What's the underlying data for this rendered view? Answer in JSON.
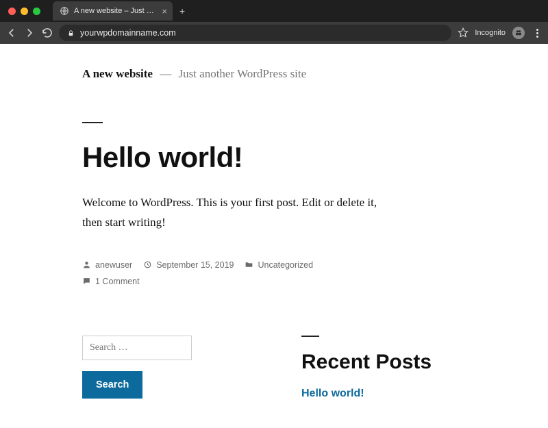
{
  "browser": {
    "tab_title": "A new website – Just another WordPress site",
    "url": "yourwpdomainname.com",
    "mode_label": "Incognito"
  },
  "site": {
    "title": "A new website",
    "separator": "—",
    "tagline": "Just another WordPress site"
  },
  "post": {
    "title": "Hello world!",
    "content": "Welcome to WordPress. This is your first post. Edit or delete it, then start writing!",
    "author": "anewuser",
    "date": "September 15, 2019",
    "category": "Uncategorized",
    "comments": "1 Comment"
  },
  "widgets": {
    "search": {
      "placeholder": "Search …",
      "button": "Search"
    },
    "recent": {
      "heading": "Recent Posts",
      "items": [
        "Hello world!"
      ]
    }
  }
}
